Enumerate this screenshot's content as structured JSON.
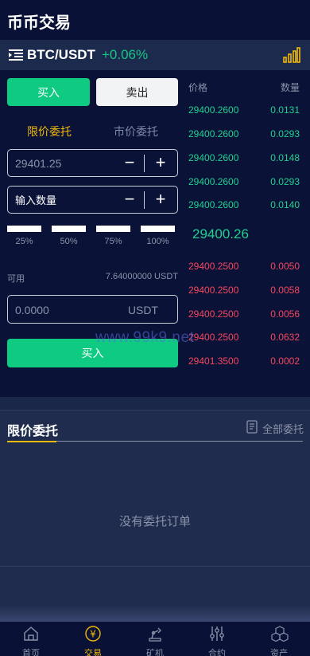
{
  "header": {
    "title": "币币交易"
  },
  "pair": {
    "name": "BTC/USDT",
    "change": "+0.06%"
  },
  "trade": {
    "buy_tab": "买入",
    "sell_tab": "卖出",
    "limit_order": "限价委托",
    "market_order": "市价委托",
    "price_placeholder": "29401.25",
    "qty_placeholder": "输入数量",
    "minus": "−",
    "plus": "+",
    "percents": [
      "25%",
      "50%",
      "75%",
      "100%"
    ],
    "available_label": "可用",
    "available_value": "7.64000000 USDT",
    "amount_placeholder": "0.0000",
    "amount_unit": "USDT",
    "buy_button": "买入"
  },
  "orderbook": {
    "price_header": "价格",
    "qty_header": "数量",
    "bids": [
      {
        "price": "29400.2600",
        "qty": "0.0131"
      },
      {
        "price": "29400.2600",
        "qty": "0.0293"
      },
      {
        "price": "29400.2600",
        "qty": "0.0148"
      },
      {
        "price": "29400.2600",
        "qty": "0.0293"
      },
      {
        "price": "29400.2600",
        "qty": "0.0140"
      }
    ],
    "last_price": "29400.26",
    "asks": [
      {
        "price": "29400.2500",
        "qty": "0.0050"
      },
      {
        "price": "29400.2500",
        "qty": "0.0058"
      },
      {
        "price": "29400.2500",
        "qty": "0.0056"
      },
      {
        "price": "29400.2500",
        "qty": "0.0632"
      },
      {
        "price": "29401.3500",
        "qty": "0.0002"
      }
    ]
  },
  "watermark": "www.99k9.net",
  "orders": {
    "title": "限价委托",
    "all_link": "全部委托",
    "empty_text": "没有委托订单"
  },
  "tabbar": {
    "items": [
      {
        "label": "首页",
        "icon": "home-icon"
      },
      {
        "label": "交易",
        "icon": "yen-coin-icon"
      },
      {
        "label": "矿机",
        "icon": "robot-arm-icon"
      },
      {
        "label": "合约",
        "icon": "sliders-icon"
      },
      {
        "label": "资产",
        "icon": "cubes-icon"
      }
    ],
    "active_index": 1
  },
  "colors": {
    "background": "#0b1238",
    "green": "#0ecb81",
    "red": "#f5475c",
    "accent": "#f0b90b"
  }
}
